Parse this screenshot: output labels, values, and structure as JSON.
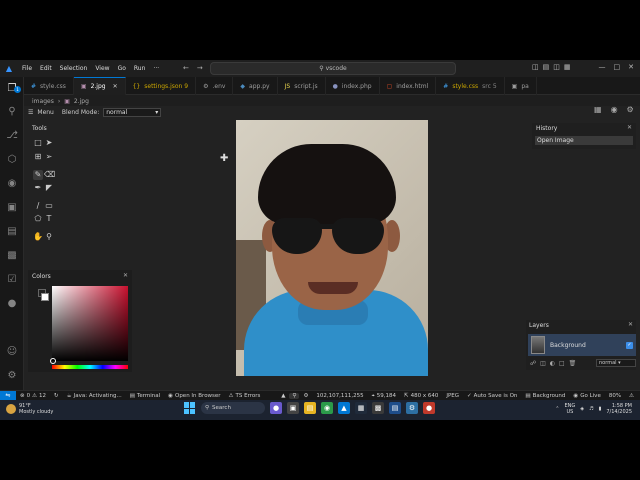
{
  "titlebar": {
    "menu": [
      "File",
      "Edit",
      "Selection",
      "View",
      "Go",
      "Run",
      "···"
    ],
    "search": "vscode"
  },
  "tabs": [
    {
      "label": "style.css",
      "icon": "#"
    },
    {
      "label": "2.jpg",
      "icon": "▣",
      "active": true
    },
    {
      "label": "settings.json 9",
      "icon": "{}",
      "modified": true
    },
    {
      "label": ".env",
      "icon": "⚙"
    },
    {
      "label": "app.py",
      "icon": "◆"
    },
    {
      "label": "script.js",
      "icon": "JS"
    },
    {
      "label": "index.php",
      "icon": "●"
    },
    {
      "label": "index.html",
      "icon": "▢"
    },
    {
      "label": "style.css",
      "icon": "#",
      "suffix": "src 5"
    },
    {
      "label": "pa",
      "icon": "▣"
    }
  ],
  "breadcrumb": [
    "images",
    "›",
    "2.jpg"
  ],
  "app": {
    "menu_label": "Menu",
    "blend_label": "Blend Mode:",
    "blend_value": "normal",
    "tools_title": "Tools",
    "colors_title": "Colors",
    "history_title": "History",
    "history_items": [
      "Open Image"
    ],
    "layers_title": "Layers",
    "layer_name": "Background",
    "layer_blend": "normal"
  },
  "statusbar": {
    "errors": "0",
    "warnings": "12",
    "java": "Java: Activating...",
    "terminal": "Terminal",
    "browser": "Open In Browser",
    "ts": "TS Errors",
    "ip": "102,107,111,255",
    "coords": "59,184",
    "size": "480 x 640",
    "format": "JPEG",
    "autosave": "Auto Save is On",
    "background": "Background",
    "golive": "Go Live",
    "zoom": "80%"
  },
  "taskbar": {
    "temp": "91°F",
    "weather": "Mostly cloudy",
    "search": "Search",
    "lang1": "ENG",
    "lang2": "US",
    "time": "1:58 PM",
    "date": "7/14/2025"
  }
}
